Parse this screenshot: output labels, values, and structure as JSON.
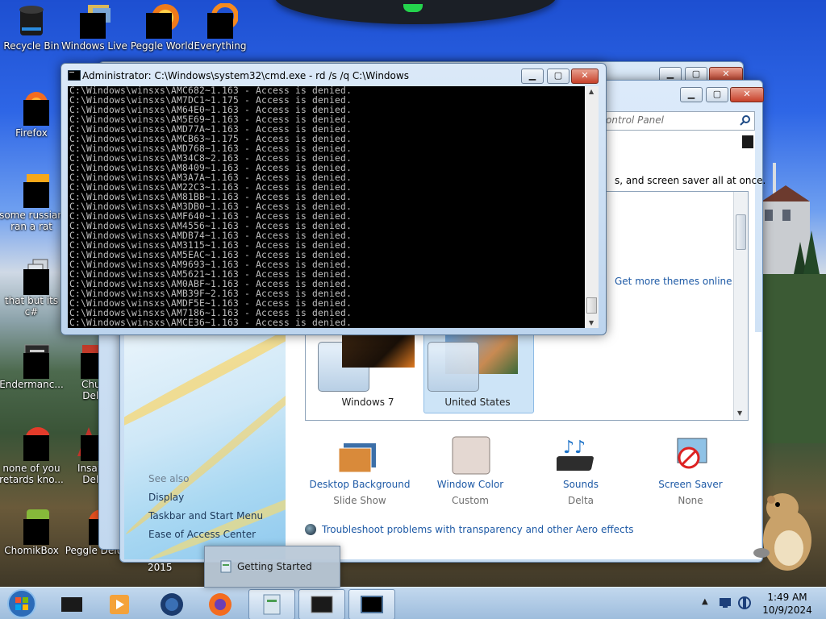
{
  "desktop_icons": [
    {
      "label": "Recycle Bin"
    },
    {
      "label": "Windows Live"
    },
    {
      "label": "Peggle World"
    },
    {
      "label": "Everything"
    },
    {
      "label": "Firefox"
    },
    {
      "label": "some russian ran a rat"
    },
    {
      "label": "that but its c#"
    },
    {
      "label": "Endermanc..."
    },
    {
      "label": "Chuz Delu"
    },
    {
      "label": "none of you retards kno..."
    },
    {
      "label": "Insaniq Delu"
    },
    {
      "label": "ChomikBox"
    },
    {
      "label": "Peggle Delux"
    }
  ],
  "back_window": {
    "taskbar_year": "2015"
  },
  "cmd": {
    "title": "Administrator: C:\\Windows\\system32\\cmd.exe - rd  /s /q C:\\Windows",
    "lines": [
      "C:\\Windows\\winsxs\\AMC682~1.163 - Access is denied.",
      "C:\\Windows\\winsxs\\AM7DC1~1.175 - Access is denied.",
      "C:\\Windows\\winsxs\\AM64E0~1.163 - Access is denied.",
      "C:\\Windows\\winsxs\\AM5E69~1.163 - Access is denied.",
      "C:\\Windows\\winsxs\\AMD77A~1.163 - Access is denied.",
      "C:\\Windows\\winsxs\\AMCB63~1.175 - Access is denied.",
      "C:\\Windows\\winsxs\\AMD768~1.163 - Access is denied.",
      "C:\\Windows\\winsxs\\AM34C8~2.163 - Access is denied.",
      "C:\\Windows\\winsxs\\AM8409~1.163 - Access is denied.",
      "C:\\Windows\\winsxs\\AM3A7A~1.163 - Access is denied.",
      "C:\\Windows\\winsxs\\AM22C3~1.163 - Access is denied.",
      "C:\\Windows\\winsxs\\AM81BB~1.163 - Access is denied.",
      "C:\\Windows\\winsxs\\AM3DB0~1.163 - Access is denied.",
      "C:\\Windows\\winsxs\\AMF640~1.163 - Access is denied.",
      "C:\\Windows\\winsxs\\AM4556~1.163 - Access is denied.",
      "C:\\Windows\\winsxs\\AMDB74~1.163 - Access is denied.",
      "C:\\Windows\\winsxs\\AM3115~1.163 - Access is denied.",
      "C:\\Windows\\winsxs\\AM5EAC~1.163 - Access is denied.",
      "C:\\Windows\\winsxs\\AM9693~1.163 - Access is denied.",
      "C:\\Windows\\winsxs\\AM5621~1.163 - Access is denied.",
      "C:\\Windows\\winsxs\\AM0ABF~1.163 - Access is denied.",
      "C:\\Windows\\winsxs\\AMB39F~2.163 - Access is denied.",
      "C:\\Windows\\winsxs\\AMDF5E~1.163 - Access is denied.",
      "C:\\Windows\\winsxs\\AM7186~1.163 - Access is denied.",
      "C:\\Windows\\winsxs\\AMCE36~1.163 - Access is denied."
    ]
  },
  "control_panel": {
    "search_placeholder": "ontrol Panel",
    "intro_text": "s, and screen saver all at once.",
    "get_more_themes": "Get more themes online",
    "themes": [
      {
        "label": "Windows 7"
      },
      {
        "label": "United States"
      }
    ],
    "bottom_items": [
      {
        "label": "Desktop Background",
        "sub": "Slide Show"
      },
      {
        "label": "Window Color",
        "sub": "Custom"
      },
      {
        "label": "Sounds",
        "sub": "Delta"
      },
      {
        "label": "Screen Saver",
        "sub": "None"
      }
    ],
    "troubleshoot": "Troubleshoot problems with transparency and other Aero effects",
    "see_also": {
      "heading": "See also",
      "links": [
        "Display",
        "Taskbar and Start Menu",
        "Ease of Access Center"
      ]
    }
  },
  "popup": {
    "label": "Getting Started"
  },
  "taskbar": {
    "time": "1:49 AM",
    "date": "10/9/2024"
  },
  "colors": {
    "cmd_text": "#c0c0c0",
    "link_blue": "#1e5aa6"
  }
}
